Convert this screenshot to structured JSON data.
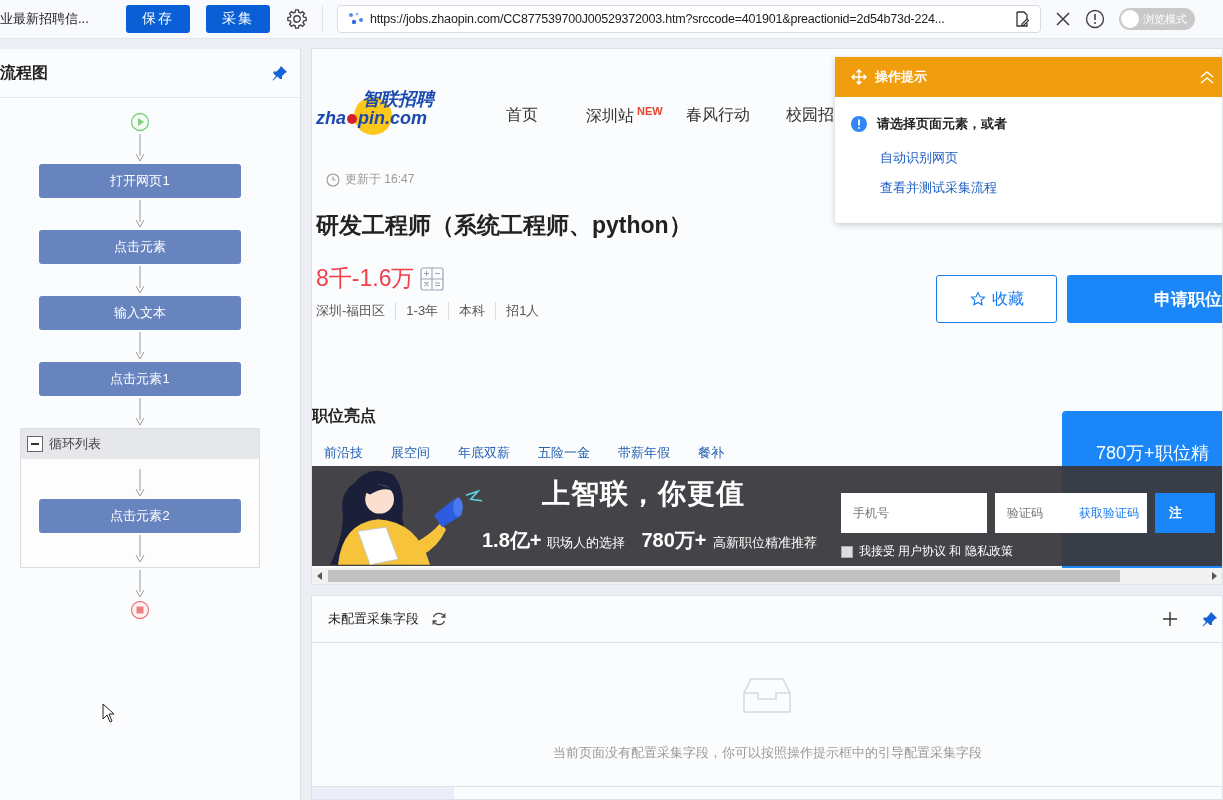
{
  "toolbar": {
    "title": "业最新招聘信...",
    "buttons": [
      {
        "label": "保存"
      },
      {
        "label": "采集"
      }
    ],
    "url": "https://jobs.zhaopin.com/CC877539700J00529372003.htm?srccode=401901&preactionid=2d54b73d-224...",
    "mode_toggle": {
      "label": "浏览模式",
      "on": false
    }
  },
  "flow_panel": {
    "title": "流程图",
    "steps": [
      {
        "kind": "start"
      },
      {
        "kind": "action",
        "label": "打开网页1"
      },
      {
        "kind": "action",
        "label": "点击元素"
      },
      {
        "kind": "action",
        "label": "输入文本"
      },
      {
        "kind": "action",
        "label": "点击元素1"
      },
      {
        "kind": "loop",
        "label": "循环列表",
        "expanded": true,
        "children": [
          {
            "kind": "action",
            "label": "点击元素2"
          }
        ]
      },
      {
        "kind": "end"
      }
    ]
  },
  "web_page": {
    "logo": {
      "cn": "智联招聘",
      "en_left": "zha",
      "en_right": "pin.com"
    },
    "nav": [
      {
        "label": "首页"
      },
      {
        "label": "深圳站",
        "badge": "NEW"
      },
      {
        "label": "春风行动"
      },
      {
        "label": "校园招"
      }
    ],
    "updated": "更新于 16:47",
    "job_title": "研发工程师（系统工程师、python）",
    "salary": "8千-1.6万",
    "meta": [
      "深圳-福田区",
      "1-3年",
      "本科",
      "招1人"
    ],
    "favorite_button": "收藏",
    "apply_button": "申请职位",
    "highlights_title": "职位亮点",
    "highlights": [
      "前沿技",
      "展空间",
      "年底双薪",
      "五险一金",
      "带薪年假",
      "餐补"
    ],
    "side_card": "780万+职位精",
    "banner": {
      "headline": "上智联，你更值",
      "stats": [
        {
          "value": "1.8亿+",
          "caption": "职场人的选择"
        },
        {
          "value": "780万+",
          "caption": "高新职位精准推荐"
        }
      ],
      "phone_placeholder": "手机号",
      "code_placeholder": "验证码",
      "code_link": "获取验证码",
      "register_button": "注",
      "agree": {
        "text": "我接受 用户协议 和 隐私政策",
        "checked": false
      }
    }
  },
  "tip_popup": {
    "title": "操作提示",
    "message": "请选择页面元素，或者",
    "links": [
      "自动识别网页",
      "查看并测试采集流程"
    ]
  },
  "fields_panel": {
    "title": "未配置采集字段",
    "empty_text": "当前页面没有配置采集字段，你可以按照操作提示框中的引导配置采集字段"
  }
}
